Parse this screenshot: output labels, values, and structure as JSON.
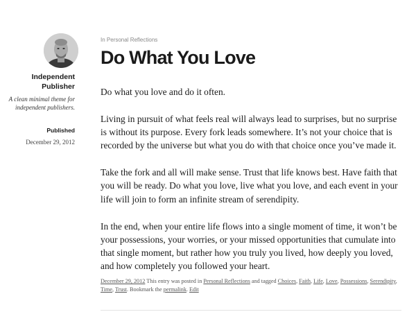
{
  "site": {
    "title": "Independent Publisher",
    "description": "A clean minimal theme for independent publishers."
  },
  "published": {
    "label": "Published",
    "date": "December 29, 2012"
  },
  "post": {
    "category_prefix": "In",
    "category": "Personal Reflections",
    "title": "Do What You Love",
    "paragraphs": [
      "Do what you love and do it often.",
      "Living in pursuit of what feels real will always lead to surprises, but no surprise is without its purpose. Every fork leads somewhere. It’s not your choice that is recorded by the universe but what you do with that choice once you’ve made it.",
      "Take the fork and all will make sense. Trust that life knows best. Have faith that you will be ready. Do what you love, live what you love, and each event in your life will join to form an infinite stream of serendipity.",
      "In the end, when your entire life flows into a single moment of time, it won’t be your possessions, your worries, or your missed opportunities that cumulate into that single moment, but rather how you truly you lived, how deeply you loved, and how completely you followed your heart."
    ]
  },
  "meta": {
    "date_link": "December 29, 2012",
    "text_posted_in": "This entry was posted in",
    "category_link": "Personal Reflections",
    "text_tagged": "and tagged",
    "tags": [
      "Choices",
      "Faith",
      "Life",
      "Love",
      "Possessions",
      "Serendipity",
      "Time",
      "Trust"
    ],
    "text_bookmark": "Bookmark the",
    "permalink": "permalink",
    "edit": "Edit"
  }
}
